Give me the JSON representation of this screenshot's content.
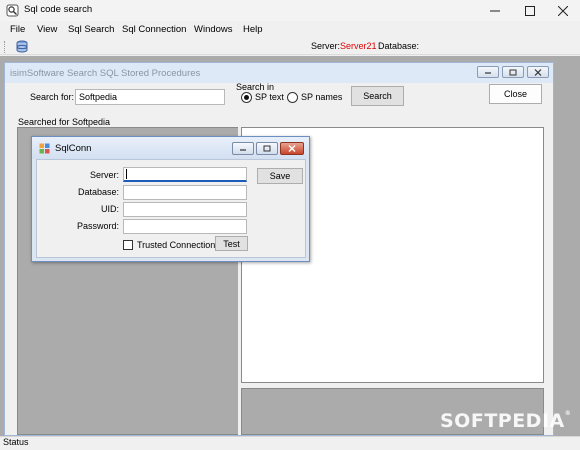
{
  "window": {
    "title": "Sql code search"
  },
  "menu": [
    "File",
    "View",
    "Sql Search",
    "Sql Connection",
    "Windows",
    "Help"
  ],
  "toolbar": {
    "server_caption": "Server:",
    "server_value": "Server21",
    "database_caption": "Database:",
    "server_value_color": "#e00000"
  },
  "child": {
    "title": "isimSoftware Search SQL Stored Procedures",
    "search_for_label": "Search for:",
    "search_value": "Softpedia",
    "search_in_label": "Search in",
    "radio_sp_text": "SP text",
    "radio_sp_names": "SP names",
    "selected_radio": "SP text",
    "search_button": "Search",
    "close_button": "Close",
    "searched_for_label": "Searched for Softpedia"
  },
  "dialog": {
    "title": "SqlConn",
    "server_label": "Server:",
    "database_label": "Database:",
    "uid_label": "UID:",
    "password_label": "Password:",
    "server_value": "",
    "database_value": "",
    "uid_value": "",
    "password_value": "",
    "save_button": "Save",
    "trusted_label": "Trusted Connection",
    "trusted_checked": false,
    "test_button": "Test"
  },
  "status": {
    "text": "Status"
  },
  "watermark": {
    "text": "SOFTPEDIA",
    "mark": "®"
  }
}
